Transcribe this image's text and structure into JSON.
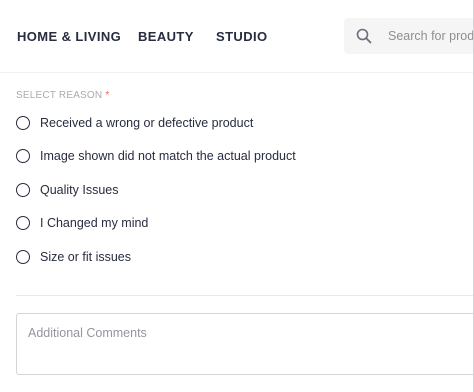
{
  "header": {
    "nav": [
      {
        "label": "HOME & LIVING"
      },
      {
        "label": "BEAUTY"
      },
      {
        "label": "STUDIO"
      }
    ],
    "search": {
      "placeholder": "Search for products, brands and more",
      "icon": "search-icon"
    }
  },
  "reason": {
    "heading": "SELECT REASON",
    "required_mark": "*",
    "required_color": "#ff5a5f",
    "options": [
      {
        "label": "Received a wrong or defective product",
        "selected": false
      },
      {
        "label": "Image shown did not match the actual product",
        "selected": false
      },
      {
        "label": "Quality Issues",
        "selected": false
      },
      {
        "label": "I Changed my mind",
        "selected": false
      },
      {
        "label": "Size or fit issues",
        "selected": false
      }
    ]
  },
  "comments": {
    "placeholder": "Additional Comments",
    "value": ""
  }
}
